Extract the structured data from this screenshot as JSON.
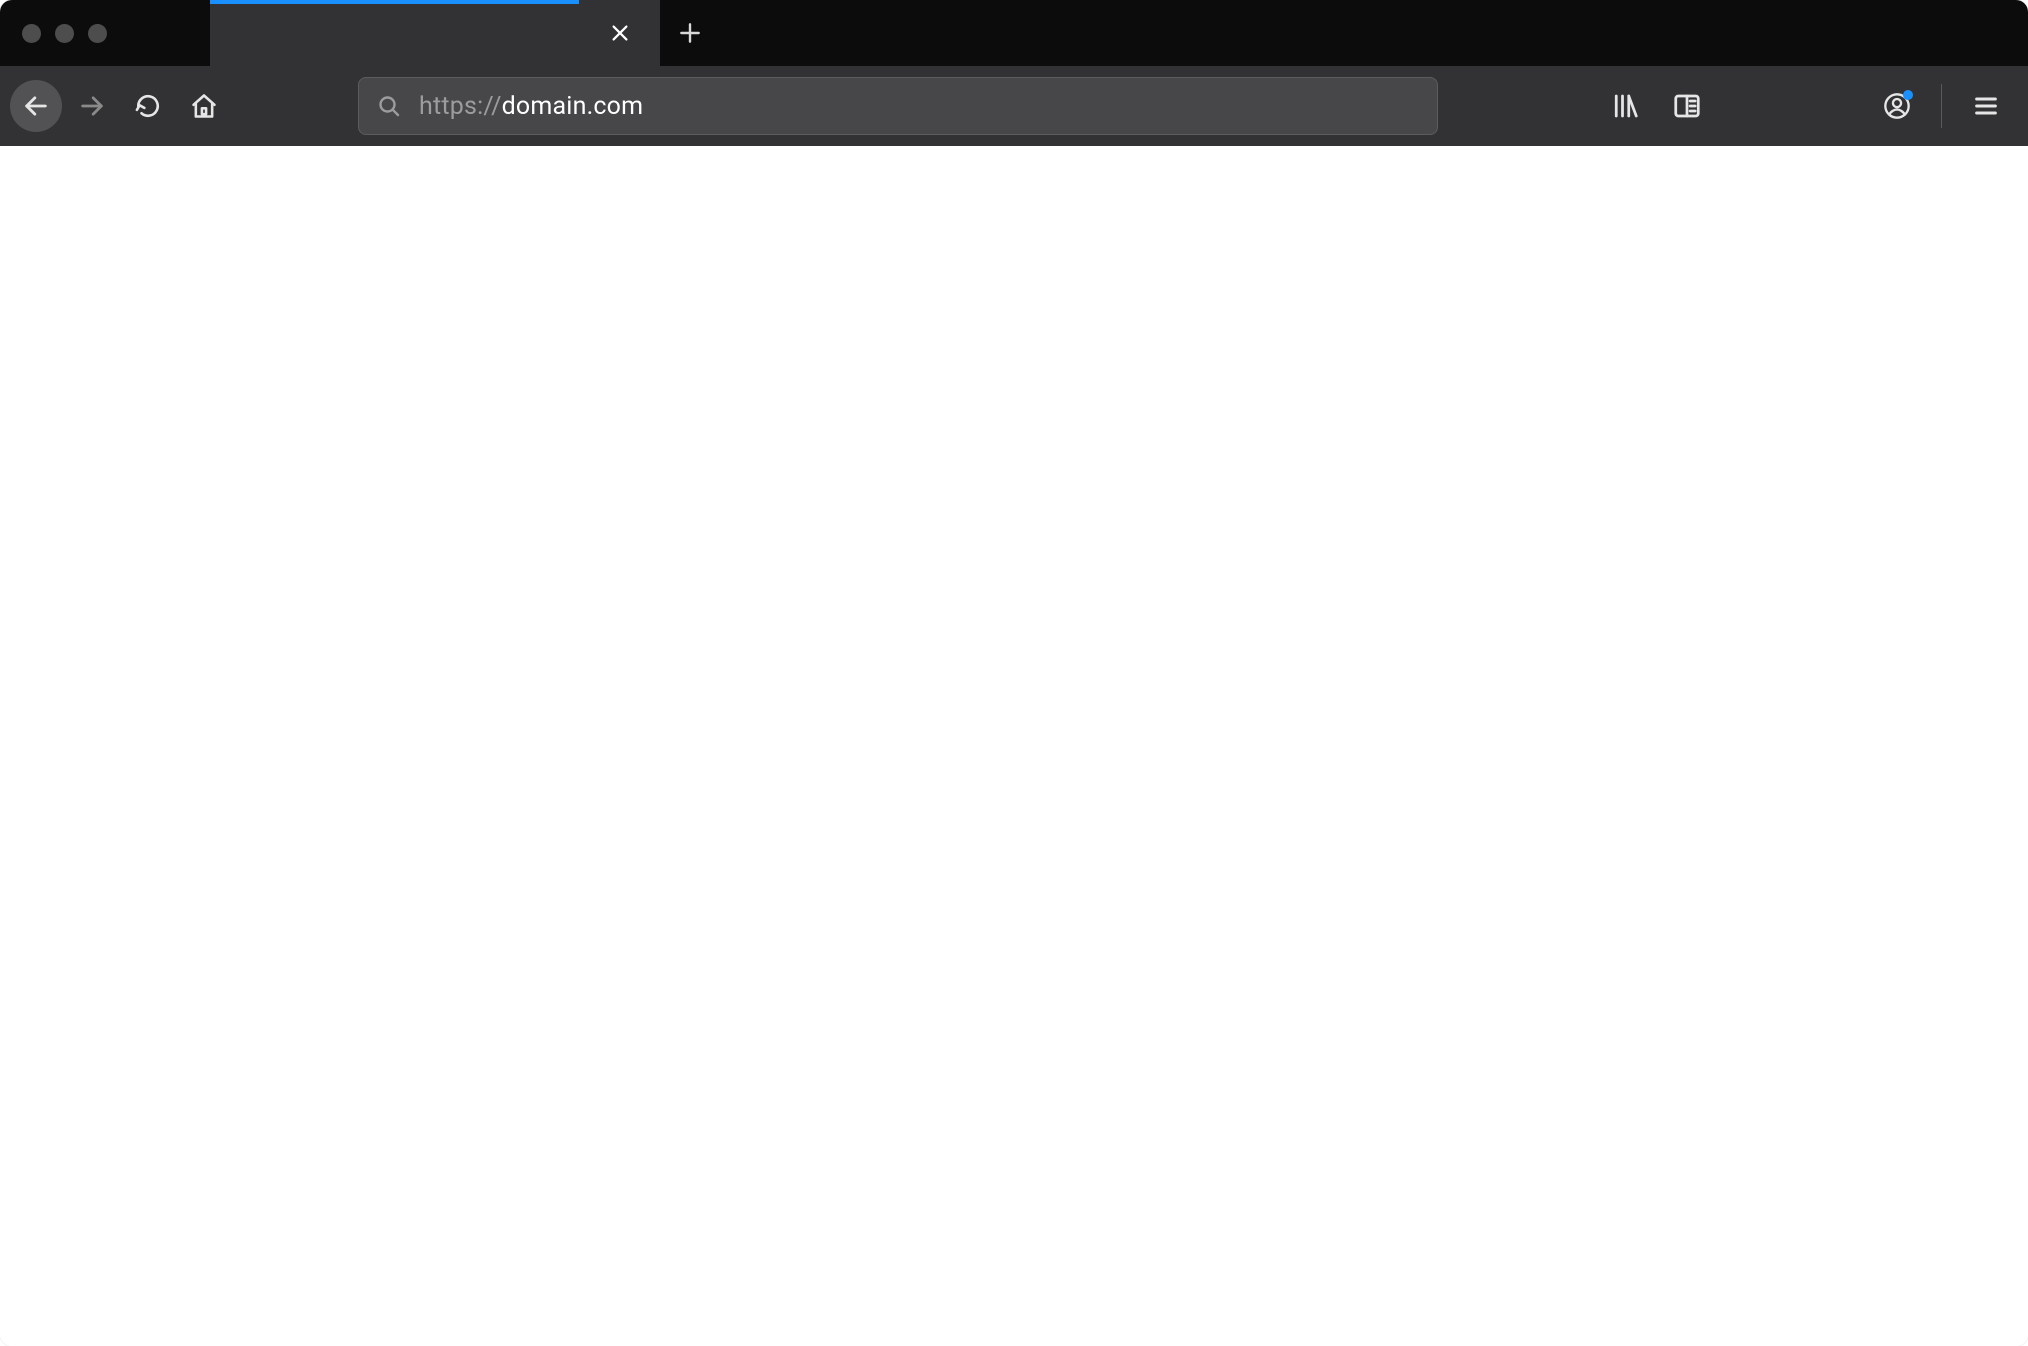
{
  "colors": {
    "accent": "#1a90ff",
    "titlebar_bg": "#0c0c0c",
    "navbar_bg": "#323234",
    "urlbar_bg": "#474749"
  },
  "tab": {
    "title": "",
    "loading_progress_pct": 82,
    "close_icon": "close-icon"
  },
  "newtab": {
    "icon": "plus-icon"
  },
  "nav": {
    "back_icon": "arrow-left-icon",
    "forward_icon": "arrow-right-icon",
    "reload_icon": "reload-icon",
    "home_icon": "home-icon"
  },
  "urlbar": {
    "search_icon": "search-icon",
    "protocol": "https://",
    "host": "domain.com"
  },
  "right": {
    "library_icon": "library-icon",
    "sidebar_icon": "sidebar-icon",
    "account_icon": "account-icon",
    "account_has_notification": true,
    "menu_icon": "hamburger-menu-icon"
  }
}
